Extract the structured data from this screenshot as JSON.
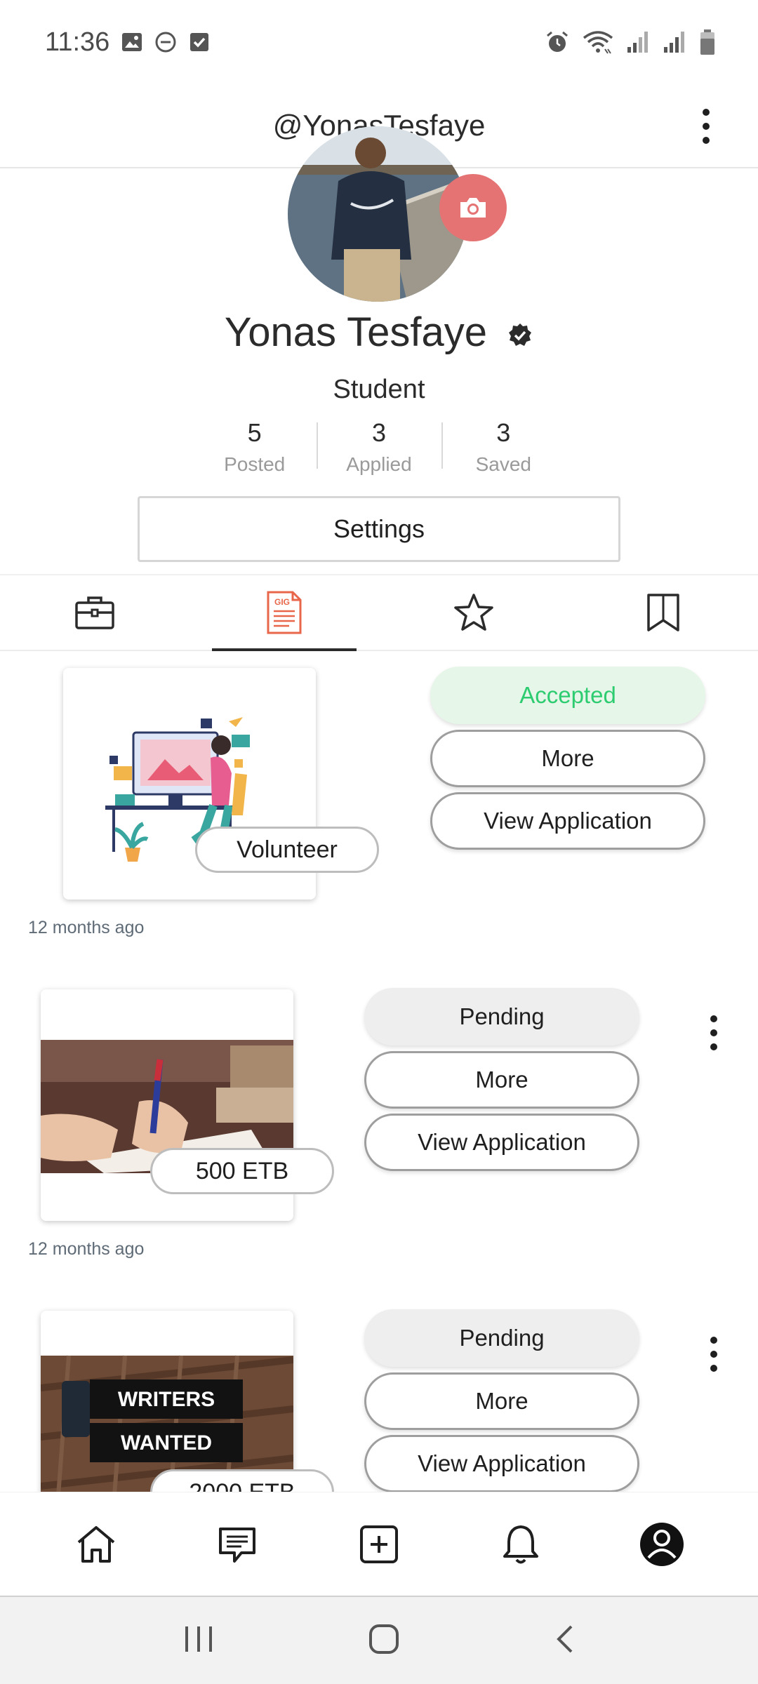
{
  "status_bar": {
    "time": "11:36",
    "icons_left": [
      "image-icon",
      "dnd-icon",
      "checkbox-icon"
    ],
    "icons_right": [
      "alarm-icon",
      "wifi-icon",
      "signal-icon",
      "signal-icon",
      "battery-icon"
    ]
  },
  "header": {
    "username": "@YonasTesfaye"
  },
  "profile": {
    "name": "Yonas Tesfaye",
    "role": "Student",
    "stats": [
      {
        "value": "5",
        "label": "Posted"
      },
      {
        "value": "3",
        "label": "Applied"
      },
      {
        "value": "3",
        "label": "Saved"
      }
    ],
    "settings_label": "Settings"
  },
  "tabs": [
    {
      "icon": "briefcase-icon",
      "active": false
    },
    {
      "icon": "gig-document-icon",
      "active": true,
      "icon_text": "GIG"
    },
    {
      "icon": "star-icon",
      "active": false
    },
    {
      "icon": "bookmark-icon",
      "active": false
    }
  ],
  "applications": [
    {
      "price": "Volunteer",
      "status": "Accepted",
      "more_label": "More",
      "view_label": "View Application",
      "time": "12 months ago"
    },
    {
      "price": "500 ETB",
      "status": "Pending",
      "more_label": "More",
      "view_label": "View Application",
      "time": "12 months ago"
    },
    {
      "price": "2000 ETB",
      "status": "Pending",
      "more_label": "More",
      "view_label": "View Application",
      "image_text_1": "WRITERS",
      "image_text_2": "WANTED"
    }
  ],
  "bottom_nav": [
    "home-icon",
    "chat-icon",
    "add-icon",
    "bell-icon",
    "profile-icon"
  ],
  "system_nav": [
    "recents-icon",
    "home-circle-icon",
    "back-icon"
  ],
  "colors": {
    "accepted_text": "#2ecc71",
    "accepted_bg": "#e6f6e8",
    "pending_bg": "#eeeeee",
    "camera_button": "#e57373",
    "gig_icon": "#e8674a"
  }
}
